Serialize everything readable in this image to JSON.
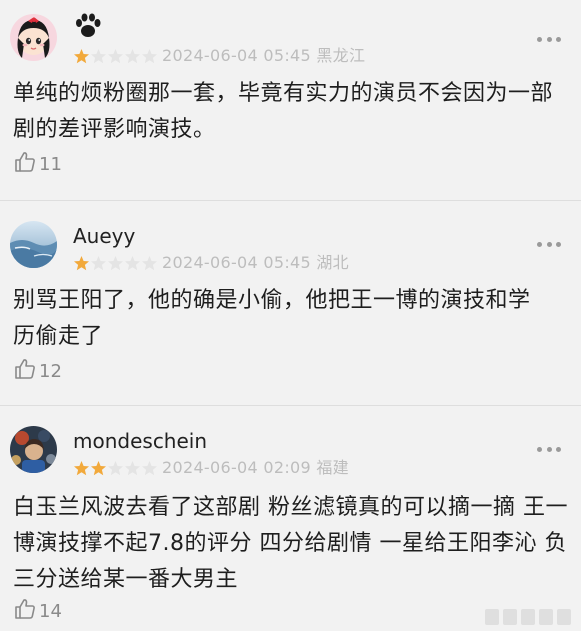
{
  "reviews": [
    {
      "username": "",
      "has_paw_badge": true,
      "rating": 1,
      "max_rating": 5,
      "date": "2024-06-04 05:45",
      "location": "黑龙江",
      "content": "单纯的烦粉圈那一套，毕竟有实力的演员不会因为一部剧的差评影响演技。",
      "likes": "11"
    },
    {
      "username": "Aueyy",
      "has_paw_badge": false,
      "rating": 1,
      "max_rating": 5,
      "date": "2024-06-04 05:45",
      "location": "湖北",
      "content": "别骂王阳了，他的确是小偷，他把王一博的演技和学历偷走了",
      "likes": "12"
    },
    {
      "username": "mondeschein",
      "has_paw_badge": false,
      "rating": 2,
      "max_rating": 5,
      "date": "2024-06-04 02:09",
      "location": "福建",
      "content": "白玉兰风波去看了这部剧 粉丝滤镜真的可以摘一摘 王一博演技撑不起7.8的评分 四分给剧情 一星给王阳李沁 负三分送给某一番大男主",
      "likes": "14"
    }
  ],
  "colors": {
    "star_filled": "#f2a93b",
    "star_empty": "#e4e4e4",
    "meta_text": "#bdbdbd",
    "background": "#f2f2f2"
  },
  "icons": {
    "more": "more-dots-icon",
    "like": "thumbs-up-icon",
    "paw": "paw-icon"
  }
}
